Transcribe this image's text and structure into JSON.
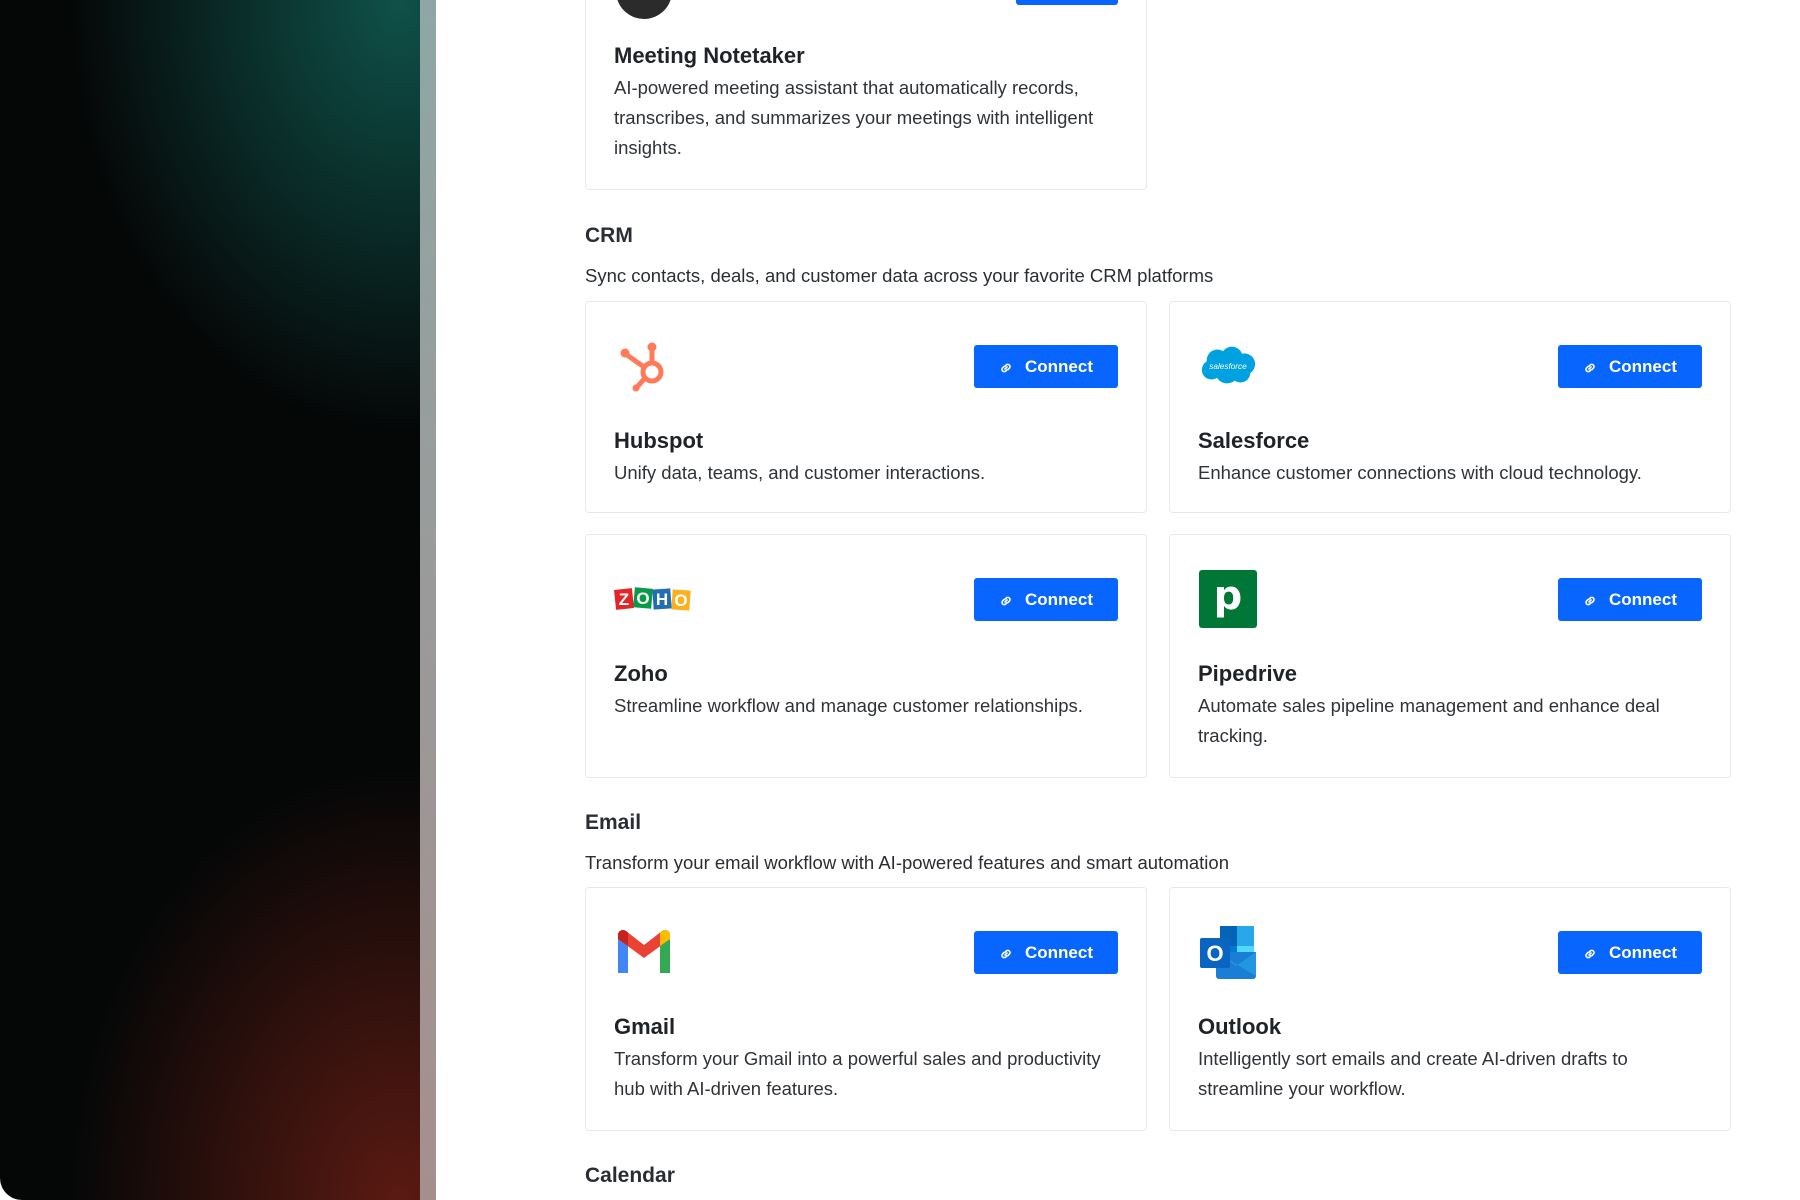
{
  "top_card": {
    "title": "Meeting Notetaker",
    "description": "AI-powered meeting assistant that automatically records, transcribes, and summarizes your meetings with intelligent insights."
  },
  "sections": {
    "crm": {
      "title": "CRM",
      "subtitle": "Sync contacts, deals, and customer data across your favorite CRM platforms",
      "cards": [
        {
          "name": "Hubspot",
          "description": "Unify data, teams, and customer interactions.",
          "button": "Connect",
          "icon": "hubspot-icon",
          "color": "#ff7a59"
        },
        {
          "name": "Salesforce",
          "description": "Enhance customer connections with cloud technology.",
          "button": "Connect",
          "icon": "salesforce-icon",
          "logo_text": "salesforce",
          "color": "#00a1e0"
        },
        {
          "name": "Zoho",
          "description": "Streamline workflow and manage customer relationships.",
          "button": "Connect",
          "icon": "zoho-icon",
          "logo_letters": [
            "Z",
            "O",
            "H",
            "O"
          ],
          "colors": [
            "#e42527",
            "#089949",
            "#226db4",
            "#f9b21d"
          ]
        },
        {
          "name": "Pipedrive",
          "description": "Automate sales pipeline management and enhance deal tracking.",
          "button": "Connect",
          "icon": "pipedrive-icon",
          "logo_letter": "p",
          "color": "#017737"
        }
      ]
    },
    "email": {
      "title": "Email",
      "subtitle": "Transform your email workflow with AI-powered features and smart automation",
      "cards": [
        {
          "name": "Gmail",
          "description": "Transform your Gmail into a powerful sales and productivity hub with AI-driven features.",
          "button": "Connect",
          "icon": "gmail-icon"
        },
        {
          "name": "Outlook",
          "description": "Intelligently sort emails and create AI-driven drafts to streamline your workflow.",
          "button": "Connect",
          "icon": "outlook-icon",
          "logo_letter": "O",
          "color": "#0a64c2"
        }
      ]
    },
    "calendar": {
      "title": "Calendar"
    }
  },
  "colors": {
    "accent": "#0866ff",
    "text": "#1f2328",
    "border": "#e6e8eb"
  }
}
